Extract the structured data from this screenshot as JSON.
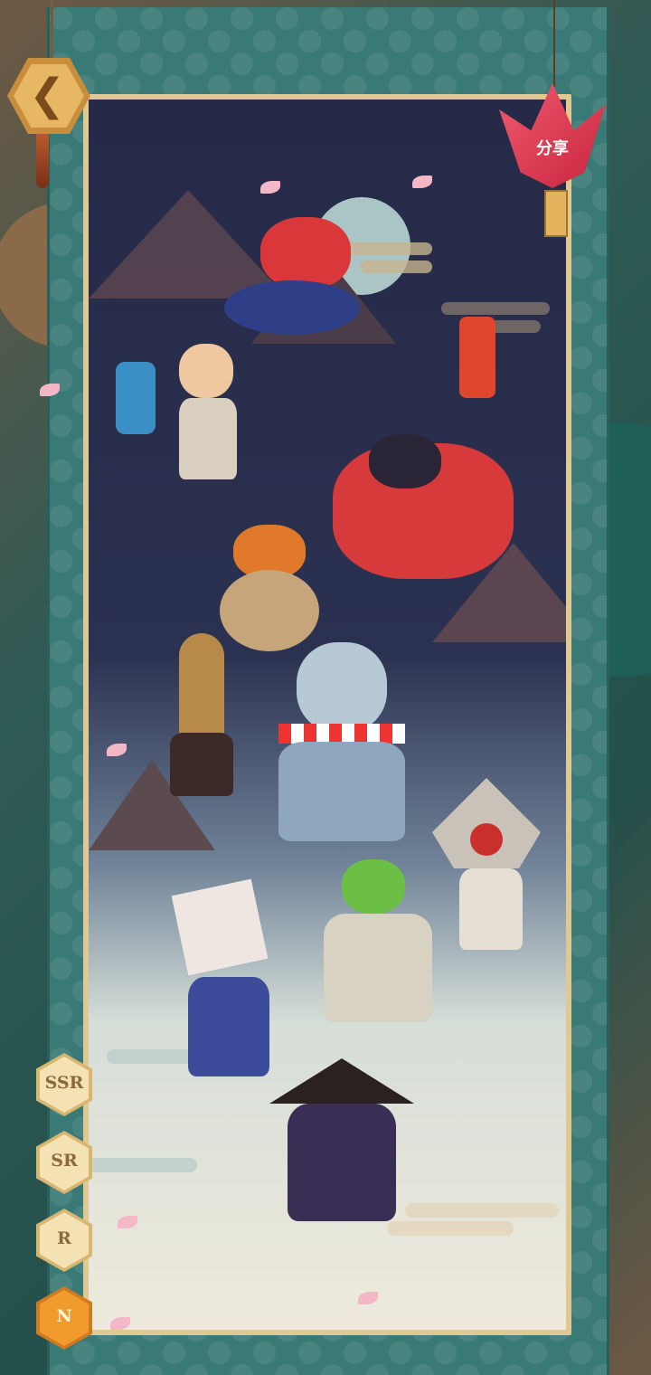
{
  "header": {
    "back_icon": "chevron-left-icon",
    "share_label": "分享",
    "share_icon": "paper-crane-icon"
  },
  "rarity_filter": {
    "items": [
      {
        "label": "SSR",
        "active": false
      },
      {
        "label": "SR",
        "active": false
      },
      {
        "label": "R",
        "active": false
      },
      {
        "label": "N",
        "active": true
      }
    ]
  },
  "colors": {
    "frame": "#3a7a76",
    "panel_border": "#e0c893",
    "accent_active": "#ef9b2d",
    "share": "#e23a52"
  }
}
